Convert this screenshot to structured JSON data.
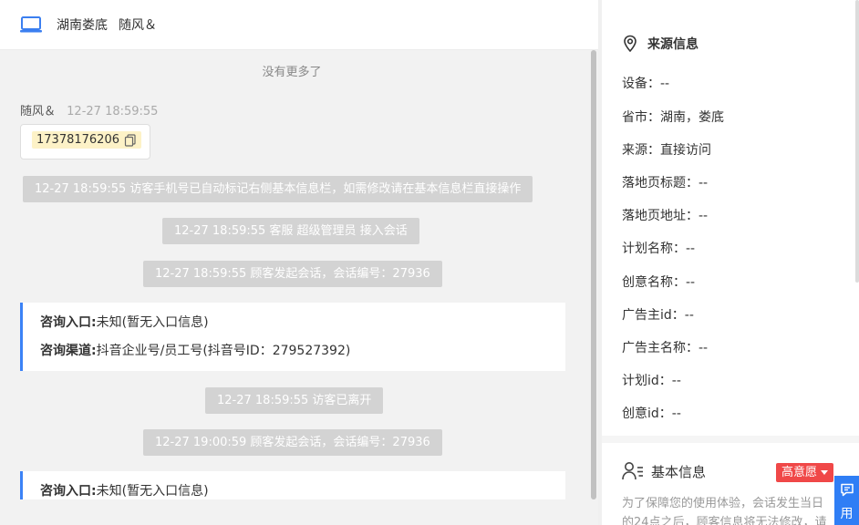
{
  "header": {
    "location": "湖南娄底",
    "visitor_name": "随风＆"
  },
  "chat": {
    "no_more": "没有更多了",
    "message": {
      "sender": "随风＆",
      "time": "12-27 18:59:55",
      "phone": "17378176206"
    },
    "system_msgs": [
      "12-27 18:59:55 访客手机号已自动标记右侧基本信息栏，如需修改请在基本信息栏直接操作",
      "12-27 18:59:55 客服 超级管理员 接入会话",
      "12-27 18:59:55 顾客发起会话，会话编号：27936",
      "12-27 18:59:55 访客已离开",
      "12-27 19:00:59 顾客发起会话，会话编号：27936"
    ],
    "info_cards": [
      {
        "entry_label": "咨询入口:",
        "entry_value": "未知(暂无入口信息)",
        "channel_label": "咨询渠道:",
        "channel_value": "抖音企业号/员工号(抖音号ID：279527392)"
      },
      {
        "entry_label": "咨询入口:",
        "entry_value": "未知(暂无入口信息)"
      }
    ]
  },
  "source_info": {
    "title": "来源信息",
    "rows": [
      "设备：--",
      "省市：湖南，娄底",
      "来源：直接访问",
      "落地页标题：--",
      "落地页地址：--",
      "计划名称：--",
      "创意名称：--",
      "广告主id：--",
      "广告主名称：--",
      "计划id：--",
      "创意id：--"
    ]
  },
  "basic_info": {
    "title": "基本信息",
    "intent_badge": "高意愿",
    "notice": "为了保障您的使用体验，会话发生当日的24点之后，顾客信息将无法修改，请"
  },
  "float_button": {
    "label": "用"
  },
  "colors": {
    "accent": "#3b82f6",
    "badge": "#f04848",
    "system_msg_bg": "#d3d3d3",
    "phone_highlight": "#fdf2c7"
  }
}
